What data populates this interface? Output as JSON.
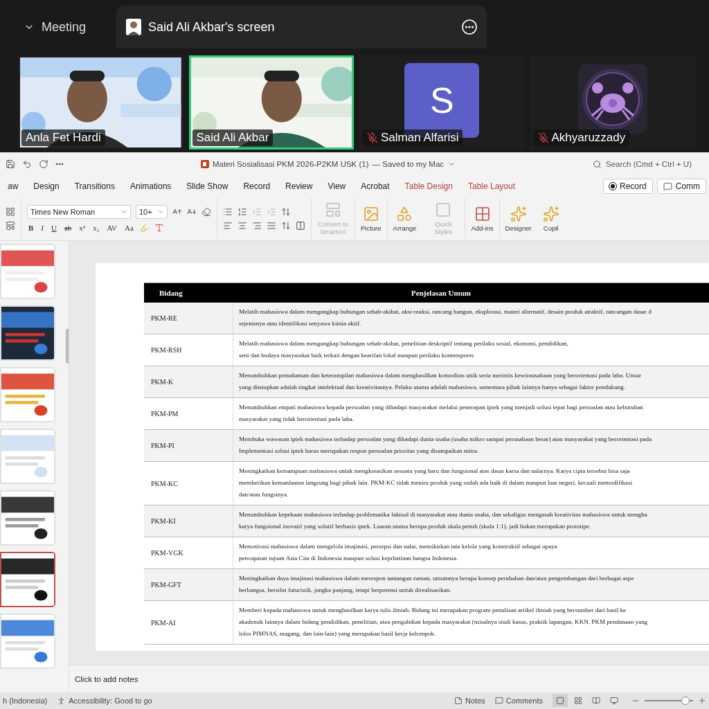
{
  "meeting": {
    "tabs": [
      {
        "label": "Meeting",
        "selected": false
      },
      {
        "label": "Said Ali Akbar's screen",
        "selected": true
      }
    ],
    "participants": [
      {
        "name": "Anla Fet Hardi",
        "kind": "video",
        "muted": false,
        "speaking": false
      },
      {
        "name": "Said Ali Akbar",
        "kind": "video",
        "muted": false,
        "speaking": true
      },
      {
        "name": "Salman Alfarisi",
        "kind": "letter",
        "initial": "S",
        "muted": true,
        "speaking": false
      },
      {
        "name": "Akhyaruzzady",
        "kind": "picture",
        "muted": true,
        "speaking": false
      }
    ]
  },
  "app": {
    "title": "Materi Sosialisasi PKM 2026-P2KM USK (1)",
    "save_status": "— Saved to my Mac",
    "search": {
      "placeholder": "Search (Cmd + Ctrl + U)"
    },
    "ribbon_tabs": [
      {
        "label": "aw",
        "kind": "normal"
      },
      {
        "label": "Design",
        "kind": "normal"
      },
      {
        "label": "Transitions",
        "kind": "normal"
      },
      {
        "label": "Animations",
        "kind": "normal"
      },
      {
        "label": "Slide Show",
        "kind": "normal"
      },
      {
        "label": "Record",
        "kind": "normal"
      },
      {
        "label": "Review",
        "kind": "normal"
      },
      {
        "label": "View",
        "kind": "normal"
      },
      {
        "label": "Acrobat",
        "kind": "normal"
      },
      {
        "label": "Table Design",
        "kind": "contextual"
      },
      {
        "label": "Table Layout",
        "kind": "contextual"
      }
    ],
    "record_button": "Record",
    "comments_button": "Comm",
    "ribbon": {
      "font": "Times New Roman",
      "size": "10+",
      "format_buttons": [
        "B",
        "I",
        "U",
        "ab",
        "x²",
        "x₂",
        "AV",
        "Aa"
      ],
      "commands": [
        {
          "label": "Convert to SmartArt",
          "kind": "smartart",
          "disabled": true
        },
        {
          "label": "Picture",
          "kind": "picture",
          "disabled": false
        },
        {
          "label": "Arrange",
          "kind": "arrange",
          "disabled": false
        },
        {
          "label": "Quick Styles",
          "kind": "styles",
          "disabled": true
        },
        {
          "label": "Add-ins",
          "kind": "addins",
          "disabled": false
        },
        {
          "label": "Designer",
          "kind": "designer",
          "disabled": false
        },
        {
          "label": "Copil",
          "kind": "copilot",
          "disabled": false
        }
      ]
    },
    "thumbnails": [
      {
        "selected": false
      },
      {
        "selected": false
      },
      {
        "selected": false
      },
      {
        "selected": false
      },
      {
        "selected": false
      },
      {
        "selected": true
      },
      {
        "selected": false
      }
    ],
    "slide": {
      "table": {
        "columns": [
          "Bidang",
          "Penjelasan Umum"
        ],
        "rows": [
          {
            "field": "PKM-RE",
            "text": "Melatih mahasiswa dalam mengungkap hubungan sebab-akibat, aksi-reaksi, rancang bangun, eksplorasi, materi alternatif, desain produk atraktif, rancangan dasar d\nsejenisnya atau identifikasi senyawa kimia aktif."
          },
          {
            "field": "PKM-RSH",
            "text": "Melatih mahasiswa dalam mengungkap hubungan sebab-akibat, penelitian deskriptif tentang perilaku sosial, ekonomi, pendidikan,\nseni dan budaya masyarakat baik terkait dengan kearifan lokal maupun perilaku kontemporer."
          },
          {
            "field": "PKM-K",
            "text": "Menumbuhkan pemahaman dan keterampilan mahasiswa dalam menghasilkan komoditas unik serta merintis kewirausahaan yang berorientasi pada laba. Unsur\nyang ditetapkan adalah tingkat intelektual dan kreativitasnya. Pelaku utama adalah mahasiswa, sementara pihak lainnya hanya sebagai faktor pendukung."
          },
          {
            "field": "PKM-PM",
            "text": "Menumbuhkan empati mahasiswa kepada persoalan yang dihadapi masyarakat melalui penerapan iptek yang menjadi solusi tepat bagi persoalan atau kebutuhan\nmasyarakat yang tidak berorientasi pada laba."
          },
          {
            "field": "PKM-PI",
            "text": "Membuka wawasan iptek mahasiswa terhadap persoalan yang dihadapi dunia usaha (usaha mikro sampai perusahaan besar) atau masyarakat yang berorientasi pada\nImplementasi solusi iptek harus merupakan respon persoalan prioritas yang disampaikan mitra."
          },
          {
            "field": "PKM-KC",
            "text": "Meningkatkan kemampuan mahasiswa untuk mengkreasikan sesuatu yang baru dan fungsional atas dasar karsa dan nalarnya. Karya cipta tersebut bisa saja\nmemberikan kemanfaatan langsung bagi pihak lain. PKM-KC tidak meniru produk yang sudah ada baik di dalam maupun luar negeri, kecuali memodifikasi\ndan/atau fungsinya."
          },
          {
            "field": "PKM-KI",
            "text": "Menumbuhkan kepekaan mahasiswa terhadap problematika faktual di masyarakat atau dunia usaha, dan sekaligus mengasah kreativitas mahasiswa untuk mengha\nkarya fungsional inovatif yang solutif berbasis iptek. Luaran utama berupa produk skala penuh (skala 1:1), jadi bukan merupakan prototipe."
          },
          {
            "field": "PKM-VGK",
            "text": "Memotivasi mahasiswa dalam mengelola imajinasi, persepsi dan nalar, memikirkan tata kelola yang konstruktif sebagai upaya\npencapaian tujuan Asta Cita di Indonesia maupun solusi keprhatinan bangsa Indonesia."
          },
          {
            "field": "PKM-GFT",
            "text": "Meningkatkan daya imajinasi mahasiswa dalam merespon tantangan zaman, umumnya berupa konsep perubahan dan/atau pengembangan dari berbagai aspe\nberbangsa, bersifat futuristik, jangka panjang, tetapi berpotensi untuk direalisasikan."
          },
          {
            "field": "PKM-AI",
            "text": "Memberi kepada mahasiswa untuk menghasilkan karya tulis ilmiah. Bidang ini merupakan program penulisan artikel ilmiah yang bersumber dari hasil ke\nakademik lainnya dalam bidang pendidikan, penelitian, atau pengabdian kepada masyarakat (misalnya studi kasus, praktik lapangan, KKN, PKM pendanaan yang\nlolos PIMNAS, magang, dan lain-lain) yang merupakan hasil kerja kelompok."
          }
        ]
      }
    },
    "notes": {
      "placeholder": "Click to add notes"
    },
    "status_bar": {
      "language": "h (Indonesia)",
      "accessibility": "Accessibility: Good to go",
      "notes": "Notes",
      "comments": "Comments",
      "zoom": {
        "level": 0.82
      }
    }
  }
}
